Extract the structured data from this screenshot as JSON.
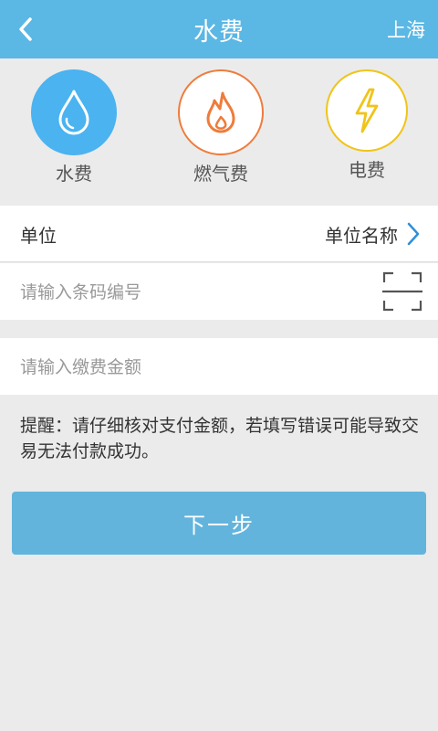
{
  "header": {
    "title": "水费",
    "city": "上海"
  },
  "categories": [
    {
      "label": "水费",
      "icon": "water-drop-icon",
      "color": "#4ab3f0",
      "active": true
    },
    {
      "label": "燃气费",
      "icon": "flame-icon",
      "color": "#ef7c3b",
      "active": false
    },
    {
      "label": "电费",
      "icon": "lightning-icon",
      "color": "#f0c419",
      "active": false
    }
  ],
  "form": {
    "unit_label": "单位",
    "unit_value": "单位名称",
    "barcode_placeholder": "请输入条码编号",
    "amount_placeholder": "请输入缴费金额"
  },
  "reminder": "提醒：请仔细核对支付金额，若填写错误可能导致交易无法付款成功。",
  "next_button": "下一步",
  "colors": {
    "header": "#5bb7e3",
    "button": "#62b4dc",
    "link_arrow": "#2f8fd8"
  }
}
